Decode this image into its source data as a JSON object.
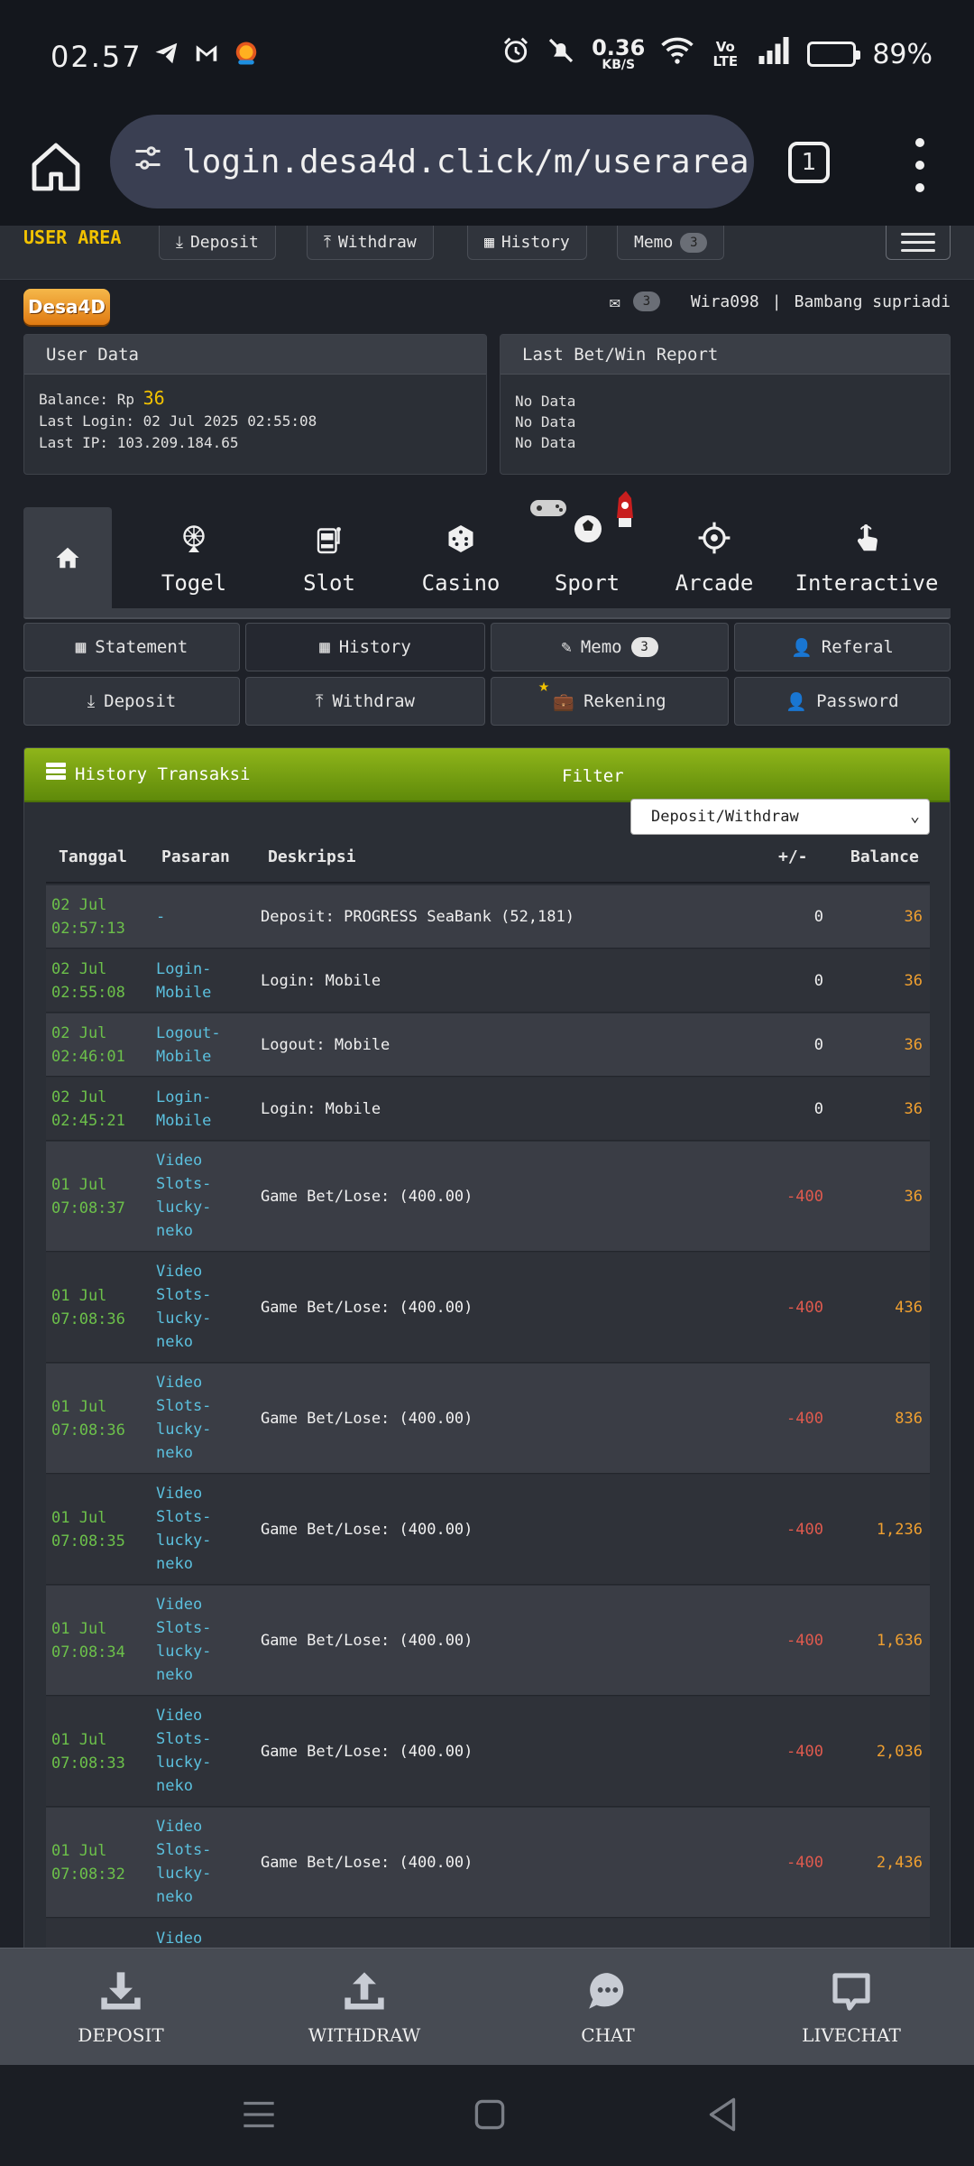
{
  "status_bar": {
    "time": "02.57",
    "net_speed": "0.36",
    "net_unit": "KB/S",
    "volte": "Vo LTE",
    "battery": "89%",
    "battery_level": 0.89
  },
  "browser": {
    "url": "login.desa4d.click/m/userarea",
    "tab_count": "1"
  },
  "topnav": {
    "title": "USER AREA",
    "deposit": "Deposit",
    "withdraw": "Withdraw",
    "history": "History",
    "memo": "Memo",
    "memo_count": "3"
  },
  "logo": "Desa4D",
  "userline": {
    "mail_count": "3",
    "username": "Wira098",
    "separator": "|",
    "fullname": "Bambang supriadi"
  },
  "user_data": {
    "title": "User Data",
    "balance_label": "Balance: Rp",
    "balance": "36",
    "last_login": "Last Login: 02 Jul 2025 02:55:08",
    "last_ip": "Last IP: 103.209.184.65"
  },
  "last_bet": {
    "title": "Last Bet/Win Report",
    "lines": [
      "No Data",
      "No Data",
      "No Data"
    ]
  },
  "game_tabs": [
    "Togel",
    "Slot",
    "Casino",
    "Sport",
    "Arcade",
    "Interactive"
  ],
  "menu": {
    "statement": "Statement",
    "history": "History",
    "memo": "Memo",
    "memo_count": "3",
    "referal": "Referal",
    "deposit": "Deposit",
    "withdraw": "Withdraw",
    "rekening": "Rekening",
    "password": "Password"
  },
  "history": {
    "title": "History Transaksi",
    "filter_label": "Filter",
    "filter_value": "Deposit/Withdraw",
    "columns": {
      "tanggal": "Tanggal",
      "pasaran": "Pasaran",
      "deskripsi": "Deskripsi",
      "change": "+/-",
      "balance": "Balance"
    },
    "rows": [
      {
        "date": "02 Jul",
        "time": "02:57:13",
        "pasaran": [
          "-"
        ],
        "desc": "Deposit: PROGRESS SeaBank (52,181)",
        "change": "0",
        "balance": "36"
      },
      {
        "date": "02 Jul",
        "time": "02:55:08",
        "pasaran": [
          "Login-",
          "Mobile"
        ],
        "desc": "Login: Mobile",
        "change": "0",
        "balance": "36"
      },
      {
        "date": "02 Jul",
        "time": "02:46:01",
        "pasaran": [
          "Logout-",
          "Mobile"
        ],
        "desc": "Logout: Mobile",
        "change": "0",
        "balance": "36"
      },
      {
        "date": "02 Jul",
        "time": "02:45:21",
        "pasaran": [
          "Login-",
          "Mobile"
        ],
        "desc": "Login: Mobile",
        "change": "0",
        "balance": "36"
      },
      {
        "date": "01 Jul",
        "time": "07:08:37",
        "pasaran": [
          "Video",
          "Slots-",
          "lucky-",
          "neko"
        ],
        "desc": "Game Bet/Lose: (400.00)",
        "change": "-400",
        "balance": "36"
      },
      {
        "date": "01 Jul",
        "time": "07:08:36",
        "pasaran": [
          "Video",
          "Slots-",
          "lucky-",
          "neko"
        ],
        "desc": "Game Bet/Lose: (400.00)",
        "change": "-400",
        "balance": "436"
      },
      {
        "date": "01 Jul",
        "time": "07:08:36",
        "pasaran": [
          "Video",
          "Slots-",
          "lucky-",
          "neko"
        ],
        "desc": "Game Bet/Lose: (400.00)",
        "change": "-400",
        "balance": "836"
      },
      {
        "date": "01 Jul",
        "time": "07:08:35",
        "pasaran": [
          "Video",
          "Slots-",
          "lucky-",
          "neko"
        ],
        "desc": "Game Bet/Lose: (400.00)",
        "change": "-400",
        "balance": "1,236"
      },
      {
        "date": "01 Jul",
        "time": "07:08:34",
        "pasaran": [
          "Video",
          "Slots-",
          "lucky-",
          "neko"
        ],
        "desc": "Game Bet/Lose: (400.00)",
        "change": "-400",
        "balance": "1,636"
      },
      {
        "date": "01 Jul",
        "time": "07:08:33",
        "pasaran": [
          "Video",
          "Slots-",
          "lucky-",
          "neko"
        ],
        "desc": "Game Bet/Lose: (400.00)",
        "change": "-400",
        "balance": "2,036"
      },
      {
        "date": "01 Jul",
        "time": "07:08:32",
        "pasaran": [
          "Video",
          "Slots-",
          "lucky-",
          "neko"
        ],
        "desc": "Game Bet/Lose: (400.00)",
        "change": "-400",
        "balance": "2,436"
      },
      {
        "date": "",
        "time": "",
        "pasaran": [
          "Video"
        ],
        "desc": "",
        "change": "",
        "balance": ""
      }
    ]
  },
  "bottom_bar": [
    "DEPOSIT",
    "WITHDRAW",
    "CHAT",
    "LIVECHAT"
  ],
  "colors": {
    "accent_yellow": "#f2c200",
    "date_green": "#6cc04a",
    "pasaran_blue": "#5bc0de",
    "negative_red": "#e05a4e",
    "balance_orange": "#f0a030",
    "header_green": "#7aa514"
  }
}
